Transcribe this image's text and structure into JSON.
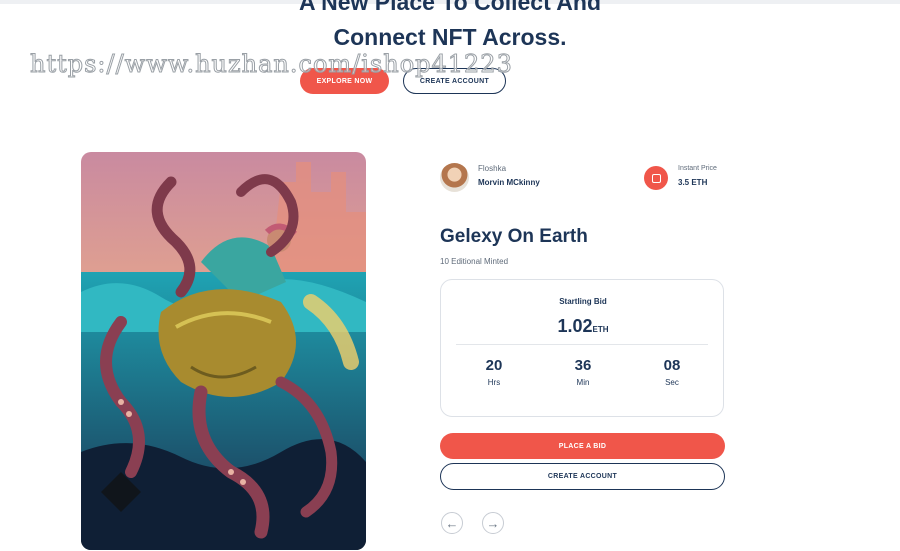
{
  "hero": {
    "title_line1": "A New Place To Collect And",
    "title_line2": "Connect NFT Across.",
    "explore_label": "EXPLORE NOW",
    "create_label": "CREATE ACCOUNT"
  },
  "watermark": "https://www.huzhan.com/ishop41223",
  "nft": {
    "image_icon": "graffiti-octopus-artwork",
    "creator_role": "Floshka",
    "creator_name": "Morvin MCkinny",
    "price_label": "Instant Price",
    "price_value": "3.5 ETH",
    "title": "Gelexy On Earth",
    "subtitle": "10 Editional Minted",
    "bid_label": "Startling Bid",
    "bid_amount": "1.02",
    "bid_unit": "ETH",
    "countdown": [
      {
        "value": "20",
        "unit": "Hrs"
      },
      {
        "value": "36",
        "unit": "Min"
      },
      {
        "value": "08",
        "unit": "Sec"
      }
    ],
    "place_bid_label": "PLACE A BID",
    "create_account_label": "CREATE ACCOUNT",
    "prev_arrow": "←",
    "next_arrow": "→"
  },
  "colors": {
    "accent": "#f0564a",
    "navy": "#1d3557"
  }
}
